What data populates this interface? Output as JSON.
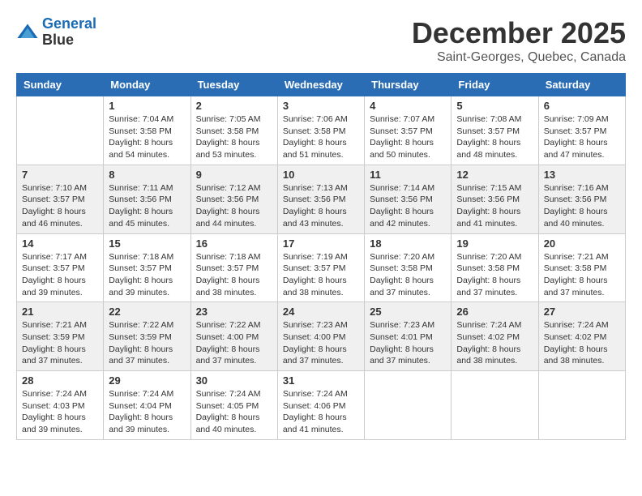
{
  "header": {
    "logo_line1": "General",
    "logo_line2": "Blue",
    "month_title": "December 2025",
    "subtitle": "Saint-Georges, Quebec, Canada"
  },
  "weekdays": [
    "Sunday",
    "Monday",
    "Tuesday",
    "Wednesday",
    "Thursday",
    "Friday",
    "Saturday"
  ],
  "weeks": [
    [
      {
        "day": "",
        "sunrise": "",
        "sunset": "",
        "daylight": ""
      },
      {
        "day": "1",
        "sunrise": "Sunrise: 7:04 AM",
        "sunset": "Sunset: 3:58 PM",
        "daylight": "Daylight: 8 hours and 54 minutes."
      },
      {
        "day": "2",
        "sunrise": "Sunrise: 7:05 AM",
        "sunset": "Sunset: 3:58 PM",
        "daylight": "Daylight: 8 hours and 53 minutes."
      },
      {
        "day": "3",
        "sunrise": "Sunrise: 7:06 AM",
        "sunset": "Sunset: 3:58 PM",
        "daylight": "Daylight: 8 hours and 51 minutes."
      },
      {
        "day": "4",
        "sunrise": "Sunrise: 7:07 AM",
        "sunset": "Sunset: 3:57 PM",
        "daylight": "Daylight: 8 hours and 50 minutes."
      },
      {
        "day": "5",
        "sunrise": "Sunrise: 7:08 AM",
        "sunset": "Sunset: 3:57 PM",
        "daylight": "Daylight: 8 hours and 48 minutes."
      },
      {
        "day": "6",
        "sunrise": "Sunrise: 7:09 AM",
        "sunset": "Sunset: 3:57 PM",
        "daylight": "Daylight: 8 hours and 47 minutes."
      }
    ],
    [
      {
        "day": "7",
        "sunrise": "Sunrise: 7:10 AM",
        "sunset": "Sunset: 3:57 PM",
        "daylight": "Daylight: 8 hours and 46 minutes."
      },
      {
        "day": "8",
        "sunrise": "Sunrise: 7:11 AM",
        "sunset": "Sunset: 3:56 PM",
        "daylight": "Daylight: 8 hours and 45 minutes."
      },
      {
        "day": "9",
        "sunrise": "Sunrise: 7:12 AM",
        "sunset": "Sunset: 3:56 PM",
        "daylight": "Daylight: 8 hours and 44 minutes."
      },
      {
        "day": "10",
        "sunrise": "Sunrise: 7:13 AM",
        "sunset": "Sunset: 3:56 PM",
        "daylight": "Daylight: 8 hours and 43 minutes."
      },
      {
        "day": "11",
        "sunrise": "Sunrise: 7:14 AM",
        "sunset": "Sunset: 3:56 PM",
        "daylight": "Daylight: 8 hours and 42 minutes."
      },
      {
        "day": "12",
        "sunrise": "Sunrise: 7:15 AM",
        "sunset": "Sunset: 3:56 PM",
        "daylight": "Daylight: 8 hours and 41 minutes."
      },
      {
        "day": "13",
        "sunrise": "Sunrise: 7:16 AM",
        "sunset": "Sunset: 3:56 PM",
        "daylight": "Daylight: 8 hours and 40 minutes."
      }
    ],
    [
      {
        "day": "14",
        "sunrise": "Sunrise: 7:17 AM",
        "sunset": "Sunset: 3:57 PM",
        "daylight": "Daylight: 8 hours and 39 minutes."
      },
      {
        "day": "15",
        "sunrise": "Sunrise: 7:18 AM",
        "sunset": "Sunset: 3:57 PM",
        "daylight": "Daylight: 8 hours and 39 minutes."
      },
      {
        "day": "16",
        "sunrise": "Sunrise: 7:18 AM",
        "sunset": "Sunset: 3:57 PM",
        "daylight": "Daylight: 8 hours and 38 minutes."
      },
      {
        "day": "17",
        "sunrise": "Sunrise: 7:19 AM",
        "sunset": "Sunset: 3:57 PM",
        "daylight": "Daylight: 8 hours and 38 minutes."
      },
      {
        "day": "18",
        "sunrise": "Sunrise: 7:20 AM",
        "sunset": "Sunset: 3:58 PM",
        "daylight": "Daylight: 8 hours and 37 minutes."
      },
      {
        "day": "19",
        "sunrise": "Sunrise: 7:20 AM",
        "sunset": "Sunset: 3:58 PM",
        "daylight": "Daylight: 8 hours and 37 minutes."
      },
      {
        "day": "20",
        "sunrise": "Sunrise: 7:21 AM",
        "sunset": "Sunset: 3:58 PM",
        "daylight": "Daylight: 8 hours and 37 minutes."
      }
    ],
    [
      {
        "day": "21",
        "sunrise": "Sunrise: 7:21 AM",
        "sunset": "Sunset: 3:59 PM",
        "daylight": "Daylight: 8 hours and 37 minutes."
      },
      {
        "day": "22",
        "sunrise": "Sunrise: 7:22 AM",
        "sunset": "Sunset: 3:59 PM",
        "daylight": "Daylight: 8 hours and 37 minutes."
      },
      {
        "day": "23",
        "sunrise": "Sunrise: 7:22 AM",
        "sunset": "Sunset: 4:00 PM",
        "daylight": "Daylight: 8 hours and 37 minutes."
      },
      {
        "day": "24",
        "sunrise": "Sunrise: 7:23 AM",
        "sunset": "Sunset: 4:00 PM",
        "daylight": "Daylight: 8 hours and 37 minutes."
      },
      {
        "day": "25",
        "sunrise": "Sunrise: 7:23 AM",
        "sunset": "Sunset: 4:01 PM",
        "daylight": "Daylight: 8 hours and 37 minutes."
      },
      {
        "day": "26",
        "sunrise": "Sunrise: 7:24 AM",
        "sunset": "Sunset: 4:02 PM",
        "daylight": "Daylight: 8 hours and 38 minutes."
      },
      {
        "day": "27",
        "sunrise": "Sunrise: 7:24 AM",
        "sunset": "Sunset: 4:02 PM",
        "daylight": "Daylight: 8 hours and 38 minutes."
      }
    ],
    [
      {
        "day": "28",
        "sunrise": "Sunrise: 7:24 AM",
        "sunset": "Sunset: 4:03 PM",
        "daylight": "Daylight: 8 hours and 39 minutes."
      },
      {
        "day": "29",
        "sunrise": "Sunrise: 7:24 AM",
        "sunset": "Sunset: 4:04 PM",
        "daylight": "Daylight: 8 hours and 39 minutes."
      },
      {
        "day": "30",
        "sunrise": "Sunrise: 7:24 AM",
        "sunset": "Sunset: 4:05 PM",
        "daylight": "Daylight: 8 hours and 40 minutes."
      },
      {
        "day": "31",
        "sunrise": "Sunrise: 7:24 AM",
        "sunset": "Sunset: 4:06 PM",
        "daylight": "Daylight: 8 hours and 41 minutes."
      },
      {
        "day": "",
        "sunrise": "",
        "sunset": "",
        "daylight": ""
      },
      {
        "day": "",
        "sunrise": "",
        "sunset": "",
        "daylight": ""
      },
      {
        "day": "",
        "sunrise": "",
        "sunset": "",
        "daylight": ""
      }
    ]
  ]
}
